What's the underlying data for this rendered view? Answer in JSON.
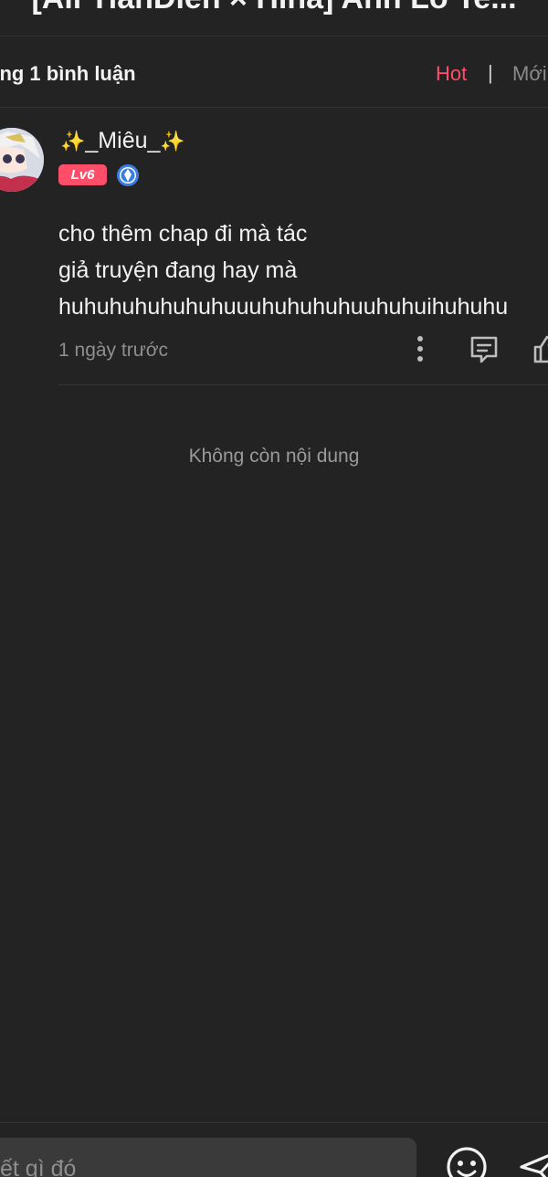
{
  "header": {
    "title": "[All TianDien × Hina] Anh Lo Te..."
  },
  "comments_header": {
    "count_label": "ổng 1 bình luận",
    "sort_hot": "Hot",
    "sort_divider": "|",
    "sort_new": "Mới"
  },
  "comment": {
    "avatar_icon": "avatar-anime-girl",
    "username_prefix": "✨",
    "username": "_Miêu_",
    "username_suffix": "✨",
    "level": "Lv6",
    "badge_icon": "verified-badge-icon",
    "text_lines": [
      "cho thêm chap đi mà tác",
      "giả truyện đang hay mà",
      "huhuhuhuhuhuhuuuhuhuhuhuuhuhuihuhuhu"
    ],
    "timestamp": "1 ngày trước",
    "actions": [
      "more-icon",
      "reply-icon",
      "like-icon"
    ]
  },
  "list_end": "Không còn nội dung",
  "composer": {
    "placeholder": "ết gì đó",
    "emoji_icon": "emoji-icon",
    "send_icon": "send-icon"
  },
  "colors": {
    "background": "#232323",
    "accent": "#ff4d6a",
    "input_bg": "#3a3a3a",
    "muted_text": "#8e8e8e"
  }
}
